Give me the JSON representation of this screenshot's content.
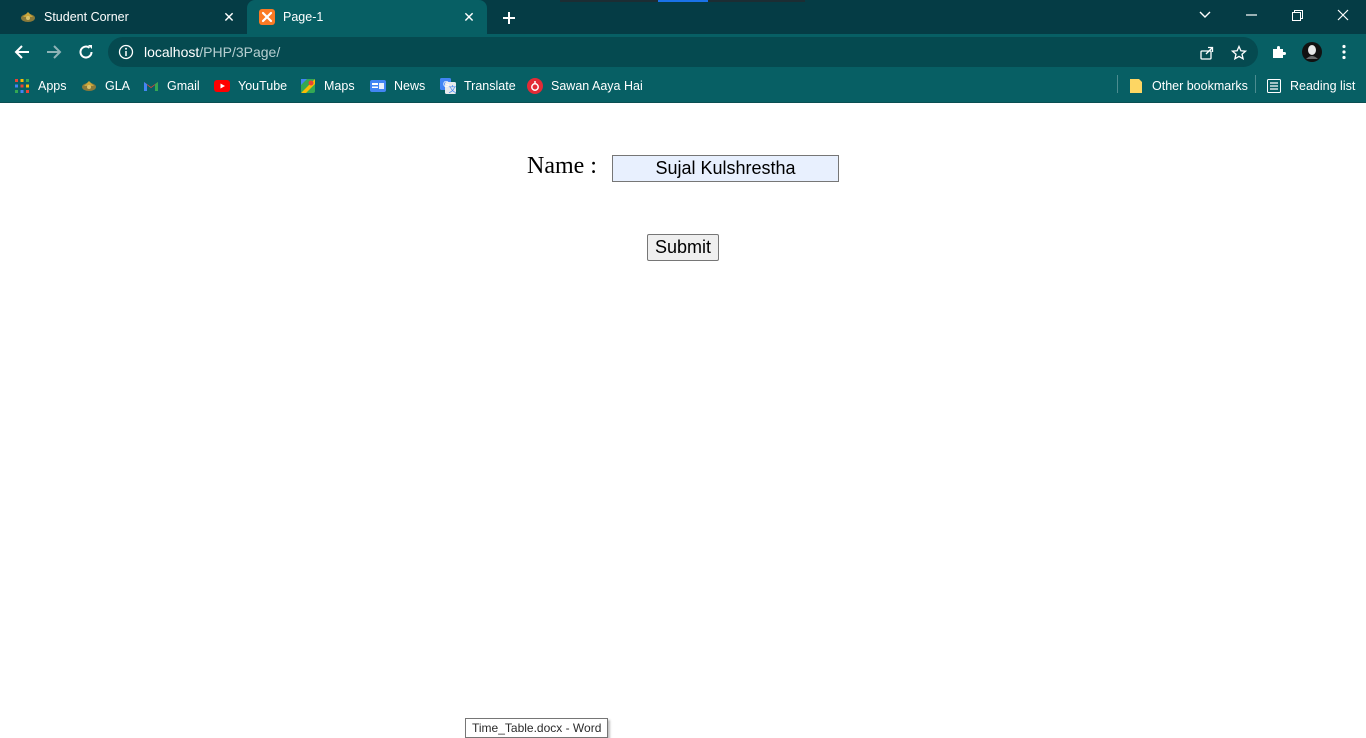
{
  "colors": {
    "tabstrip_bg": "#053c45",
    "toolbar_bg": "#075f64",
    "active_tab_bg": "#075f64",
    "input_bg": "#e8f0fe"
  },
  "tabs": [
    {
      "title": "Student Corner",
      "icon": "gla-favicon-icon",
      "active": false
    },
    {
      "title": "Page-1",
      "icon": "xampp-favicon-icon",
      "active": true
    }
  ],
  "address_bar": {
    "host": "localhost",
    "path": "/PHP/3Page/"
  },
  "bookmarks": {
    "items": [
      {
        "label": "Apps",
        "icon": "apps-grid-icon"
      },
      {
        "label": "GLA",
        "icon": "gla-icon"
      },
      {
        "label": "Gmail",
        "icon": "gmail-icon"
      },
      {
        "label": "YouTube",
        "icon": "youtube-icon"
      },
      {
        "label": "Maps",
        "icon": "maps-icon"
      },
      {
        "label": "News",
        "icon": "news-icon"
      },
      {
        "label": "Translate",
        "icon": "translate-icon"
      },
      {
        "label": "Sawan Aaya Hai",
        "icon": "music-icon"
      }
    ],
    "other_bookmarks": "Other bookmarks",
    "reading_list": "Reading list"
  },
  "form": {
    "name_label": "Name :",
    "name_value": "Sujal Kulshrestha",
    "submit_label": "Submit"
  },
  "tooltip": "Time_Table.docx - Word"
}
